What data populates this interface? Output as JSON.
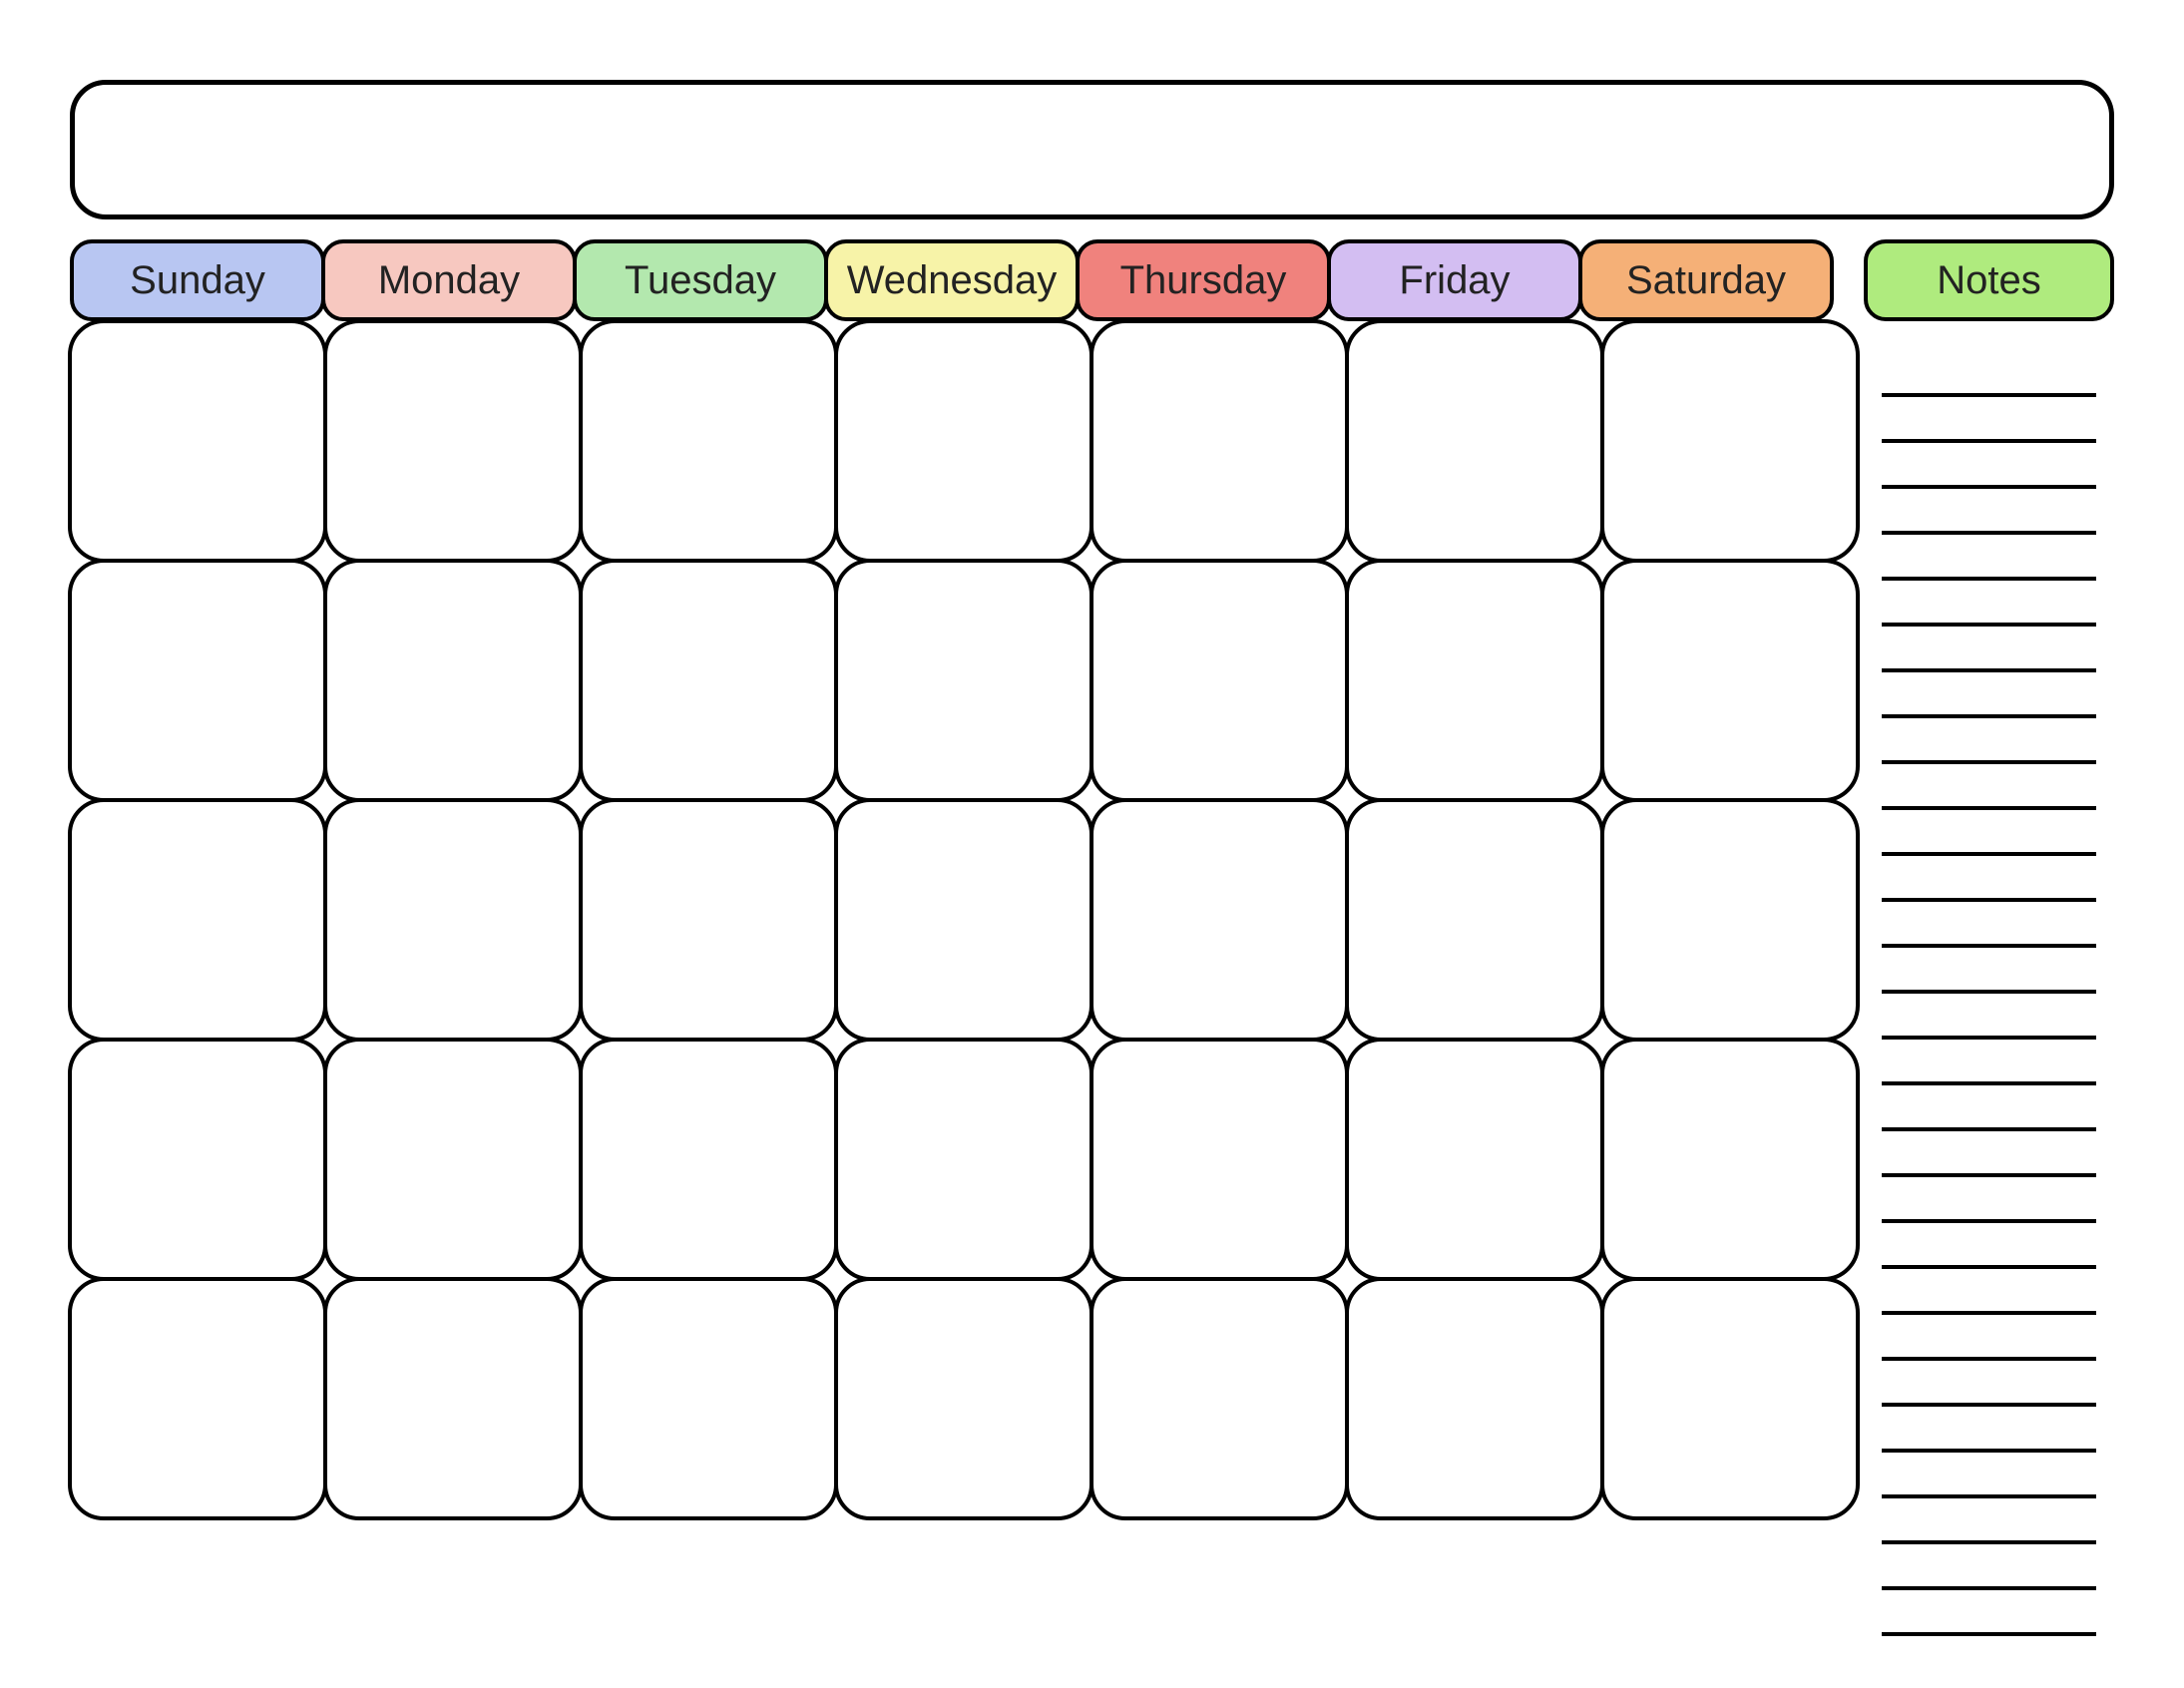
{
  "header": {
    "title": ""
  },
  "days": [
    {
      "label": "Sunday",
      "color": "#B8C6F2"
    },
    {
      "label": "Monday",
      "color": "#F7C8C0"
    },
    {
      "label": "Tuesday",
      "color": "#B3E8AE"
    },
    {
      "label": "Wednesday",
      "color": "#F7F3A8"
    },
    {
      "label": "Thursday",
      "color": "#F0827D"
    },
    {
      "label": "Friday",
      "color": "#D3BEF2"
    },
    {
      "label": "Saturday",
      "color": "#F5B077"
    }
  ],
  "notes": {
    "label": "Notes",
    "color": "#AFEB7E",
    "line_count": 28
  },
  "grid": {
    "rows": 5,
    "cols": 7
  }
}
